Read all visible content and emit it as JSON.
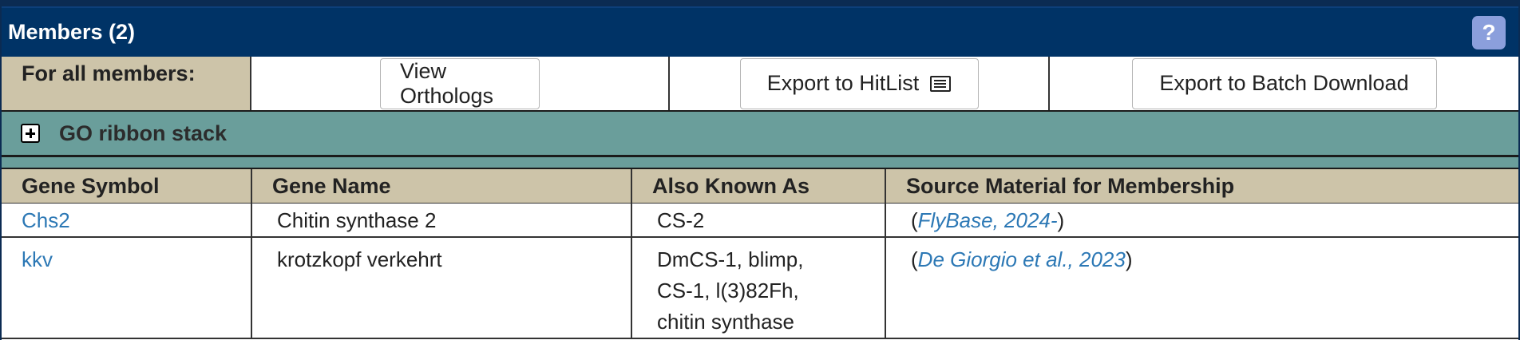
{
  "panel": {
    "title": "Members (2)",
    "help_label": "?"
  },
  "actions": {
    "label": "For all members:",
    "view_orthologs": "View Orthologs",
    "export_hitlist": "Export to HitList",
    "export_batch": "Export to Batch Download"
  },
  "go_ribbon": {
    "label": "GO ribbon stack"
  },
  "table": {
    "headers": [
      "Gene Symbol",
      "Gene Name",
      "Also Known As",
      "Source Material for Membership"
    ],
    "rows": [
      {
        "symbol": "Chs2",
        "name": "Chitin synthase 2",
        "aka": "CS-2",
        "source": "FlyBase, 2024-"
      },
      {
        "symbol": "kkv",
        "name": "krotzkopf verkehrt",
        "aka_lines": [
          "DmCS-1, blimp,",
          "CS-1, l(3)82Fh,",
          "chitin synthase"
        ],
        "source": "De Giorgio et al., 2023"
      }
    ]
  },
  "colors": {
    "header_bg": "#003366",
    "tan": "#cdc4a9",
    "teal": "#6a9e9b",
    "link": "#2c78b5",
    "help": "#8b9fdc"
  }
}
